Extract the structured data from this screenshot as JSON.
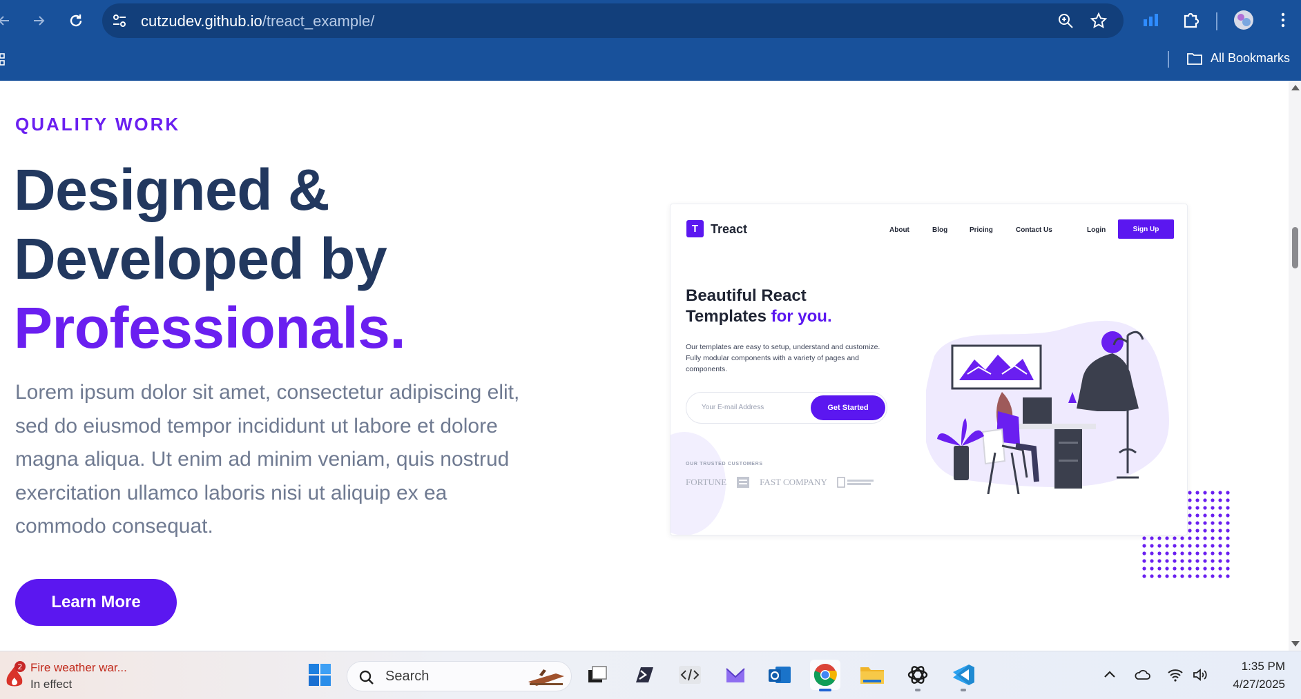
{
  "browser": {
    "url_host": "cutzudev.github.io",
    "url_path": "/treact_example/",
    "bookmarks_label": "All Bookmarks"
  },
  "hero": {
    "eyebrow": "QUALITY WORK",
    "headline_line1": "Designed &",
    "headline_line2": "Developed by",
    "headline_accent": "Professionals.",
    "paragraph": "Lorem ipsum dolor sit amet, consectetur adipiscing elit, sed do eiusmod tempor incididunt ut labore et dolore magna aliqua. Ut enim ad minim veniam, quis nostrud exercitation ullamco laboris nisi ut aliquip ex ea commodo consequat.",
    "cta_label": "Learn More"
  },
  "preview": {
    "logo_letter": "T",
    "brand": "Treact",
    "nav": [
      "About",
      "Blog",
      "Pricing",
      "Contact Us"
    ],
    "login": "Login",
    "signup": "Sign Up",
    "title_line1": "Beautiful React",
    "title_line2": "Templates ",
    "title_accent": "for you.",
    "description": "Our templates are easy to setup, understand and customize. Fully modular components with a variety of pages and components.",
    "email_placeholder": "Your E-mail Address",
    "get_started": "Get Started",
    "trusted_label": "OUR TRUSTED CUSTOMERS",
    "customer_logos": [
      "FORTUNE",
      "FAST COMPANY"
    ]
  },
  "taskbar": {
    "weather_badge": "2",
    "weather_title": "Fire weather war...",
    "weather_subtitle": "In effect",
    "search_label": "Search",
    "time": "1:35 PM",
    "date": "4/27/2025"
  },
  "colors": {
    "accent": "#6a1ff0",
    "headline": "#22385f",
    "chrome": "#18519b"
  }
}
